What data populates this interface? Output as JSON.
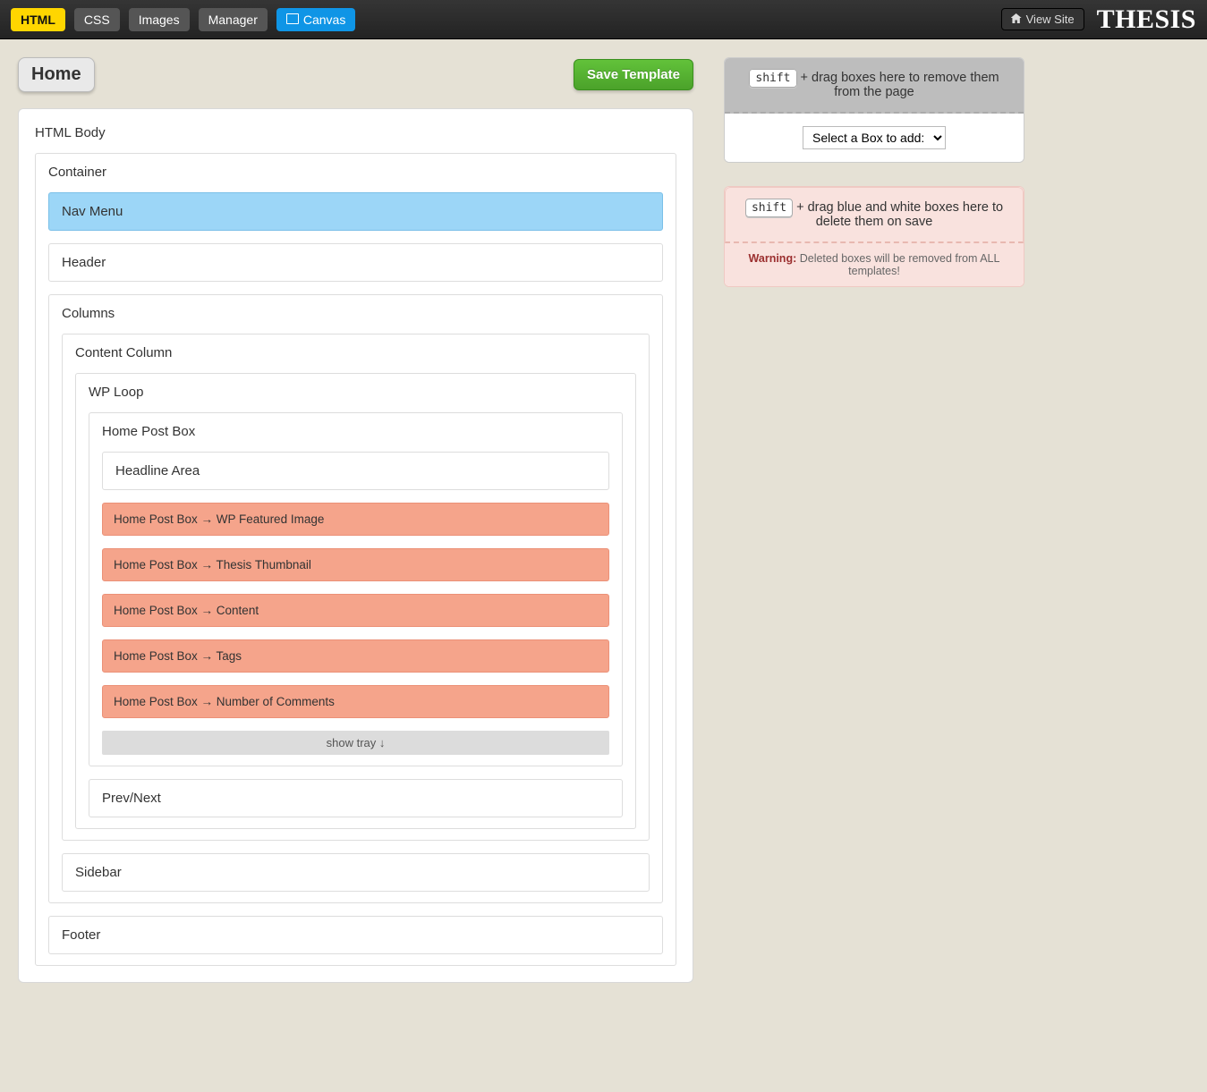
{
  "topbar": {
    "tabs": [
      {
        "label": "HTML",
        "style": "active-yellow"
      },
      {
        "label": "CSS",
        "style": ""
      },
      {
        "label": "Images",
        "style": ""
      },
      {
        "label": "Manager",
        "style": ""
      },
      {
        "label": "Canvas",
        "style": "active-blue",
        "icon": "canvas-icon"
      }
    ],
    "view_site": "View Site",
    "brand": "THESIS"
  },
  "page_title": "Home",
  "save_label": "Save Template",
  "tree": {
    "html_body": "HTML Body",
    "container": "Container",
    "nav": "Nav Menu",
    "header": "Header",
    "columns": "Columns",
    "content_col": "Content Column",
    "wp_loop": "WP Loop",
    "home_post_box": "Home Post Box",
    "headline": "Headline Area",
    "rows": [
      "Home Post Box → WP Featured Image",
      "Home Post Box → Thesis Thumbnail",
      "Home Post Box → Content",
      "Home Post Box → Tags",
      "Home Post Box → Number of Comments"
    ],
    "tray": "show tray ↓",
    "prev_next": "Prev/Next",
    "sidebar": "Sidebar",
    "footer": "Footer"
  },
  "side": {
    "shift_key": "shift",
    "remove_text": " + drag boxes here to remove them from the page",
    "select_label": "Select a Box to add:",
    "delete_text": " + drag blue and white boxes here to delete them on save",
    "warning_label": "Warning:",
    "warning_text": " Deleted boxes will be removed from ALL templates!"
  }
}
